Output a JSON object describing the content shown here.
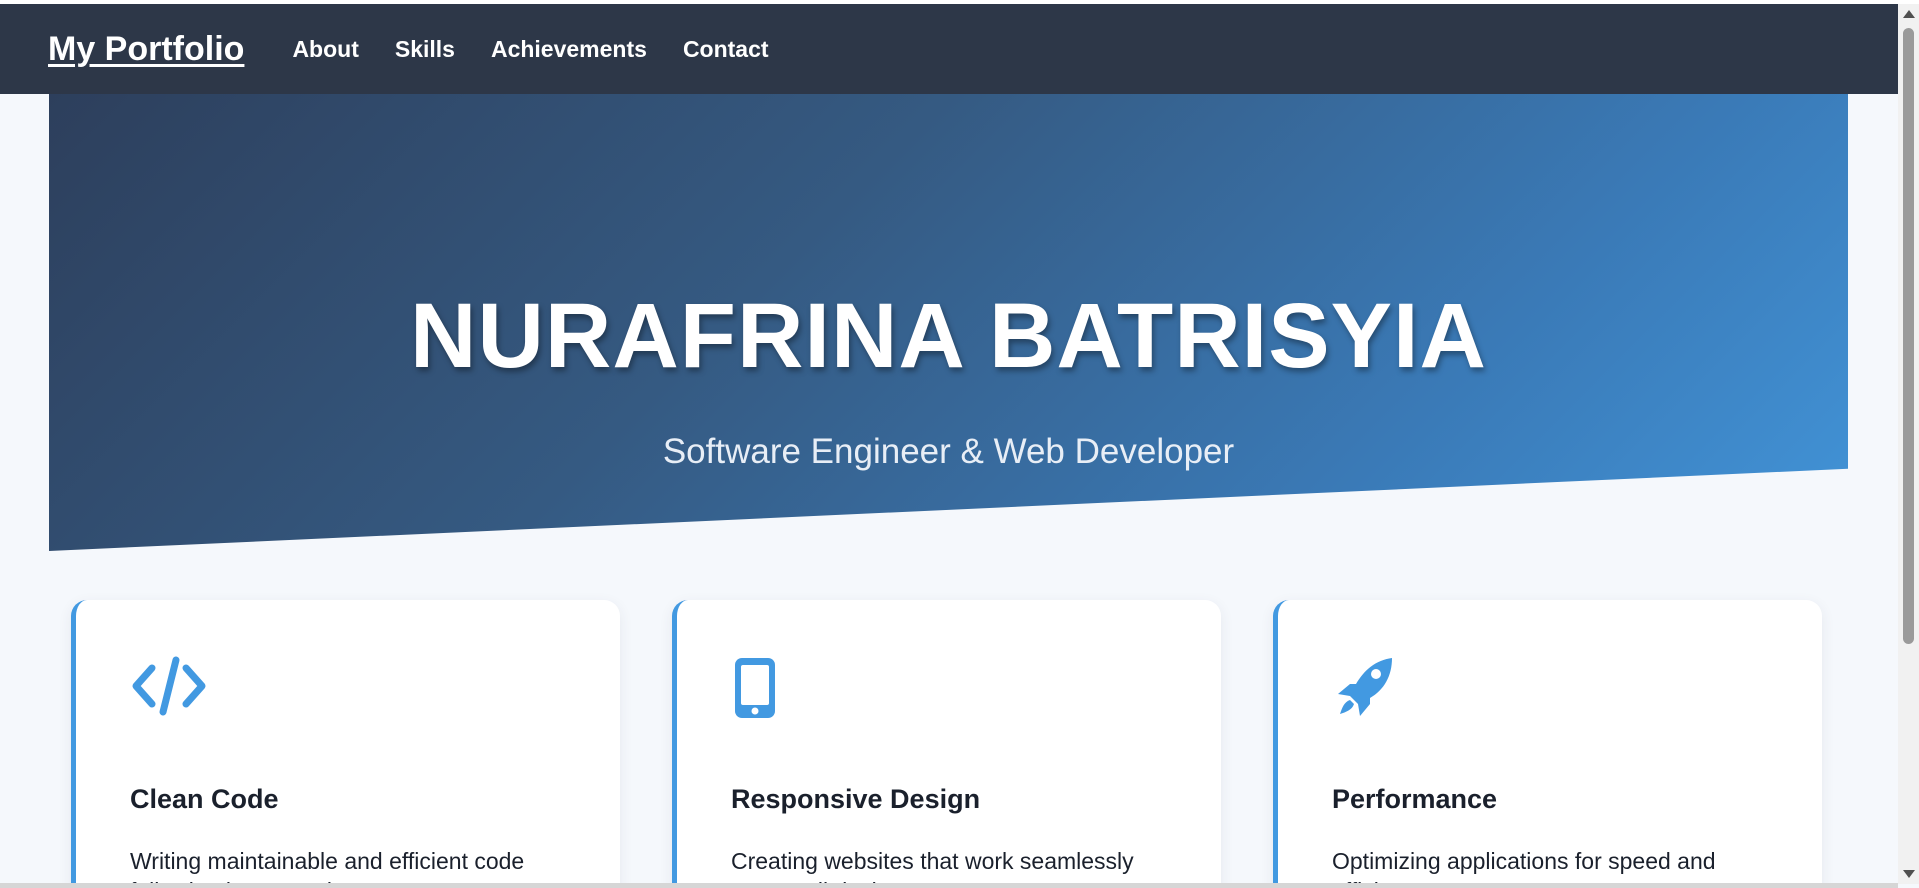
{
  "nav": {
    "brand": "My Portfolio",
    "links": [
      "About",
      "Skills",
      "Achievements",
      "Contact"
    ]
  },
  "hero": {
    "title": "NURAFRINA BATRISYIA",
    "subtitle": "Software Engineer & Web Developer"
  },
  "cards": [
    {
      "icon": "code-icon",
      "title": "Clean Code",
      "text": "Writing maintainable and efficient code following best practices"
    },
    {
      "icon": "mobile-icon",
      "title": "Responsive Design",
      "text": "Creating websites that work seamlessly across all devices"
    },
    {
      "icon": "rocket-icon",
      "title": "Performance",
      "text": "Optimizing applications for speed and efficiency"
    }
  ],
  "colors": {
    "navbar": "#2d3748",
    "accent": "#4299e1",
    "hero_start": "#2d3f5c",
    "hero_end": "#4294d8"
  }
}
